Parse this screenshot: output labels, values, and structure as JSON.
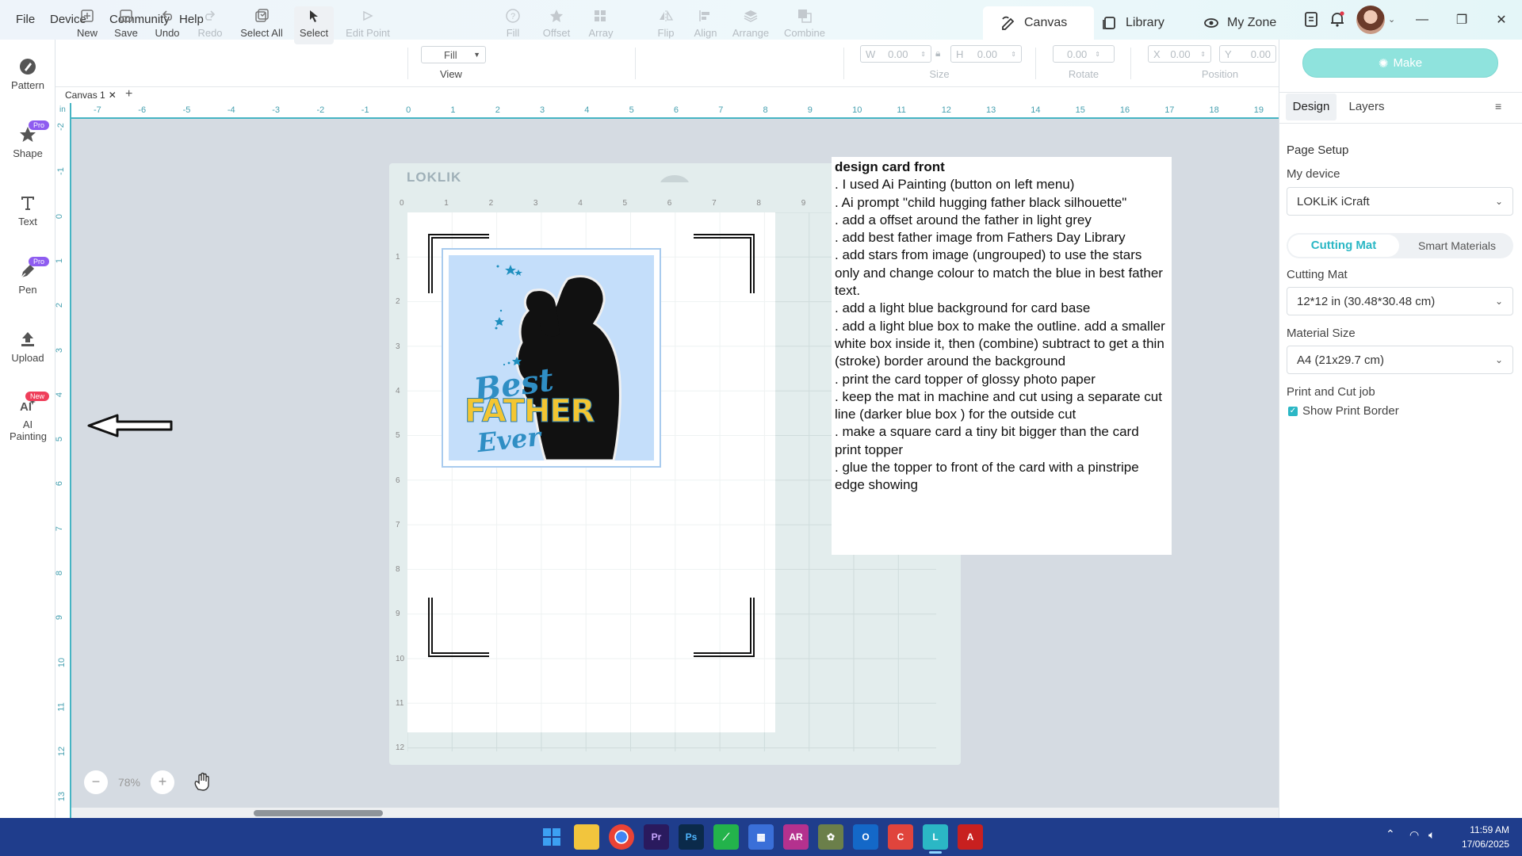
{
  "menu": {
    "file": "File",
    "device": "Device",
    "community": "Community",
    "help": "Help"
  },
  "nav": {
    "canvas": "Canvas",
    "library": "Library",
    "myzone": "My Zone"
  },
  "left_tools": [
    {
      "label": "Pattern",
      "badge": ""
    },
    {
      "label": "Shape",
      "badge": "Pro"
    },
    {
      "label": "Text",
      "badge": ""
    },
    {
      "label": "Pen",
      "badge": "Pro"
    },
    {
      "label": "Upload",
      "badge": ""
    },
    {
      "label": "AI Painting",
      "badge": "New"
    }
  ],
  "toolbar": {
    "new": "New",
    "save": "Save",
    "undo": "Undo",
    "redo": "Redo",
    "select_all": "Select All",
    "select": "Select",
    "edit_point": "Edit Point",
    "fill_mode": "Fill",
    "view": "View",
    "fill": "Fill",
    "offset": "Offset",
    "array": "Array",
    "flip": "Flip",
    "align": "Align",
    "arrange": "Arrange",
    "combine": "Combine",
    "size_label": "Size",
    "w_label": "W",
    "w_value": "0.00",
    "h_label": "H",
    "h_value": "0.00",
    "rotate_label": "Rotate",
    "rotate_value": "0.00",
    "position_label": "Position",
    "x_label": "X",
    "x_value": "0.00",
    "y_label": "Y",
    "y_value": "0.00"
  },
  "canvas_tab": {
    "name": "Canvas 1",
    "add": "+"
  },
  "ruler": {
    "unit": "in",
    "h_ticks": [
      "-7",
      "-6",
      "-5",
      "-4",
      "-3",
      "-2",
      "-1",
      "0",
      "1",
      "2",
      "3",
      "4",
      "5",
      "6",
      "7",
      "8",
      "9",
      "10",
      "11",
      "12",
      "13",
      "14",
      "15",
      "16",
      "17",
      "18",
      "19"
    ],
    "v_ticks": [
      "-2",
      "-1",
      "0",
      "1",
      "2",
      "3",
      "4",
      "5",
      "6",
      "7",
      "8",
      "9",
      "10",
      "11",
      "12",
      "13"
    ]
  },
  "mat": {
    "logo": "LOKLIK",
    "h_ticks": [
      "0",
      "1",
      "2",
      "3",
      "4",
      "5",
      "6",
      "7",
      "8",
      "9"
    ],
    "v_ticks": [
      "1",
      "2",
      "3",
      "4",
      "5",
      "6",
      "7",
      "8",
      "9",
      "10",
      "11",
      "12"
    ]
  },
  "artwork": {
    "line1": "Best",
    "line2": "FATHER",
    "line3": "Ever"
  },
  "notes": {
    "title": "design card front",
    "lines": [
      ". I used Ai Painting (button on left menu)",
      ". Ai prompt \"child hugging father black silhouette\"",
      ". add a offset around the father in light grey",
      ". add best father image from Fathers Day Library",
      ". add stars from image (ungrouped) to use the stars only and change colour to match the blue in best father text.",
      ". add a light blue background for card base",
      ". add a light blue box to make the outline. add a smaller white box inside it, then (combine) subtract to get a thin (stroke) border around the background",
      ". print the card topper of glossy photo paper",
      ". keep the mat in machine and cut using a separate cut line (darker blue box ) for the outside cut",
      ". make a square card a tiny bit bigger than the card print topper",
      ". glue the topper to front of the card with a pinstripe edge showing"
    ]
  },
  "zoom": {
    "minus": "−",
    "value": "78%",
    "plus": "+"
  },
  "right_panel": {
    "make": "Make",
    "tab_design": "Design",
    "tab_layers": "Layers",
    "page_setup": "Page Setup",
    "my_device_label": "My device",
    "my_device_value": "LOKLiK iCraft",
    "seg_cutting_mat": "Cutting Mat",
    "seg_smart_materials": "Smart Materials",
    "cutting_mat_label": "Cutting Mat",
    "cutting_mat_value": "12*12 in (30.48*30.48 cm)",
    "material_size_label": "Material Size",
    "material_size_value": "A4 (21x29.7 cm)",
    "print_cut_label": "Print and Cut job",
    "show_print_border": "Show Print Border"
  },
  "taskbar": {
    "time": "11:59 AM",
    "date": "17/06/2025"
  },
  "colors": {
    "accent": "#2bb7c5",
    "make_button": "#8fe3dd",
    "taskbar": "#1f3d8c",
    "pro_badge": "#8e5cf0",
    "new_badge": "#ef3e5a"
  }
}
